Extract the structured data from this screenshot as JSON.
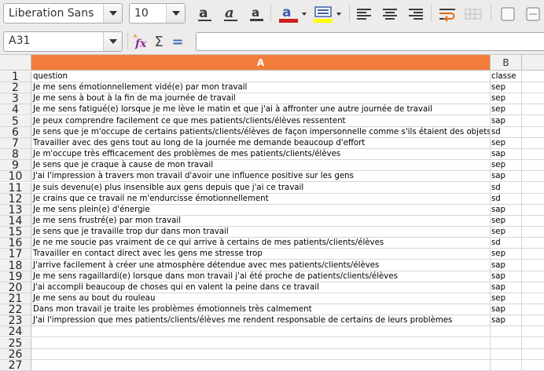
{
  "toolbar": {
    "font_name": "Liberation Sans",
    "font_size": "10",
    "colors": {
      "font_color": "#c9211e",
      "highlight_color": "#ffff00",
      "accent": "#f27d3a"
    },
    "icons": [
      "bold-icon",
      "italic-icon",
      "underline-icon",
      "font-color-icon",
      "highlight-color-icon",
      "align-left-icon",
      "align-center-icon",
      "align-right-icon",
      "wrap-text-icon",
      "merge-cells-icon",
      "border-icon"
    ]
  },
  "formula_bar": {
    "name_box": "A31",
    "function_wizard_label": "fx",
    "sum_label": "Σ",
    "equals_label": "=",
    "formula_value": ""
  },
  "grid": {
    "columns": [
      "A",
      "B"
    ],
    "selected_column": "A",
    "rows": [
      {
        "num": "1",
        "a": "question",
        "b": "classe"
      },
      {
        "num": "2",
        "a": "Je me sens émotionnellement vidé(e) par mon travail",
        "b": "sep"
      },
      {
        "num": "3",
        "a": "Je me sens à bout à la fin de ma journée de travail",
        "b": "sep"
      },
      {
        "num": "4",
        "a": "Je me sens fatigué(e) lorsque je me lève le matin et que j'ai à affronter une autre journée de travail",
        "b": "sep"
      },
      {
        "num": "5",
        "a": "Je peux comprendre facilement ce que mes patients/clients/élèves ressentent",
        "b": "sap"
      },
      {
        "num": "6",
        "a": "Je sens que je m'occupe de certains patients/clients/élèves de façon impersonnelle  comme s'ils étaient des objets",
        "b": "sd"
      },
      {
        "num": "7",
        "a": "Travailler avec des gens tout au long de la journée me demande beaucoup d'effort",
        "b": "sep"
      },
      {
        "num": "8",
        "a": "Je m'occupe très efficacement des problèmes de mes patients/clients/élèves",
        "b": "sap"
      },
      {
        "num": "9",
        "a": "Je sens que je craque à cause de mon travail",
        "b": "sep"
      },
      {
        "num": "10",
        "a": "J'ai l'impression  à travers mon travail  d'avoir une influence positive sur les gens",
        "b": "sap"
      },
      {
        "num": "11",
        "a": "Je suis devenu(e) plus insensible aux gens depuis que j'ai ce travail",
        "b": "sd"
      },
      {
        "num": "12",
        "a": "Je crains que ce travail ne m'endurcisse émotionnellement",
        "b": "sd"
      },
      {
        "num": "13",
        "a": "Je me sens plein(e) d'énergie",
        "b": "sap"
      },
      {
        "num": "14",
        "a": "Je me sens frustré(e) par mon travail",
        "b": "sep"
      },
      {
        "num": "15",
        "a": "Je sens que je travaille trop dur dans mon travail",
        "b": "sep"
      },
      {
        "num": "16",
        "a": "Je ne me soucie pas vraiment de ce qui arrive à certains de mes patients/clients/élèves",
        "b": "sd"
      },
      {
        "num": "17",
        "a": "Travailler en contact direct avec les gens me stresse trop",
        "b": "sep"
      },
      {
        "num": "18",
        "a": "J'arrive facilement à créer une atmosphère détendue avec mes patients/clients/élèves",
        "b": "sap"
      },
      {
        "num": "19",
        "a": "Je me sens ragaillardi(e) lorsque dans mon travail j'ai été proche de patients/clients/élèves",
        "b": "sap"
      },
      {
        "num": "20",
        "a": "J'ai accompli beaucoup de choses qui en valent la peine dans ce travail",
        "b": "sap"
      },
      {
        "num": "21",
        "a": "Je me sens au bout du rouleau",
        "b": "sep"
      },
      {
        "num": "22",
        "a": "Dans mon travail  je traite les problèmes émotionnels très calmement",
        "b": "sap"
      },
      {
        "num": "23",
        "a": "J'ai l'impression que mes patients/clients/élèves me rendent responsable de certains de leurs problèmes",
        "b": "sap"
      },
      {
        "num": "24",
        "a": "",
        "b": ""
      },
      {
        "num": "25",
        "a": "",
        "b": ""
      },
      {
        "num": "26",
        "a": "",
        "b": ""
      },
      {
        "num": "27",
        "a": "",
        "b": ""
      }
    ]
  }
}
